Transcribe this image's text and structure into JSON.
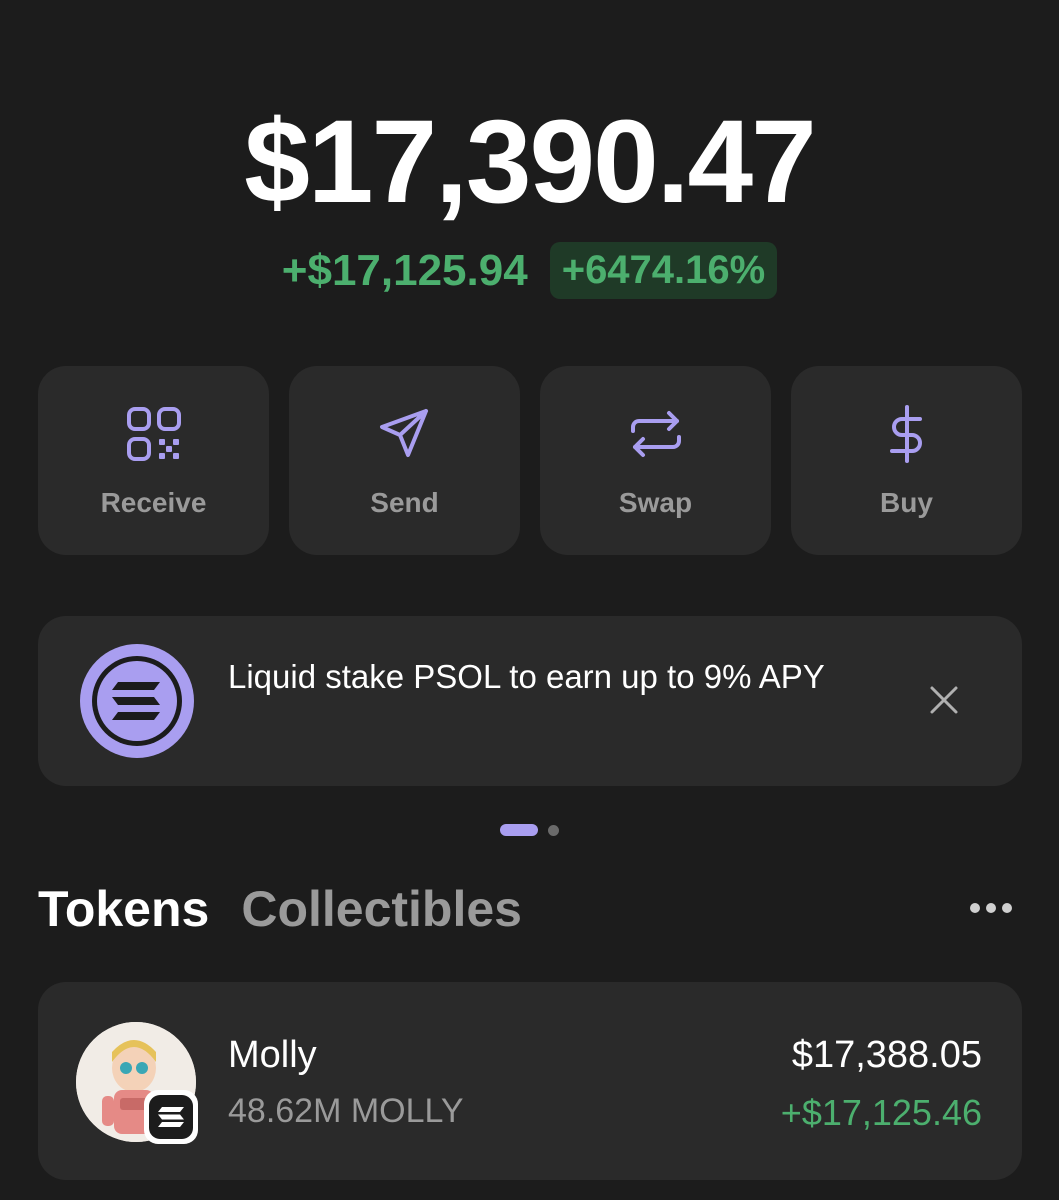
{
  "portfolio": {
    "balance": "$17,390.47",
    "change_abs": "+$17,125.94",
    "change_pct": "+6474.16%"
  },
  "actions": [
    {
      "label": "Receive",
      "icon": "qr-code-icon"
    },
    {
      "label": "Send",
      "icon": "send-arrow-icon"
    },
    {
      "label": "Swap",
      "icon": "swap-arrows-icon"
    },
    {
      "label": "Buy",
      "icon": "dollar-icon"
    }
  ],
  "promo": {
    "text": "Liquid stake PSOL to earn up to 9% APY",
    "icon": "solana-icon"
  },
  "carousel": {
    "pages": 2,
    "active": 0
  },
  "tabs": [
    {
      "label": "Tokens",
      "active": true
    },
    {
      "label": "Collectibles",
      "active": false
    }
  ],
  "tokens": [
    {
      "name": "Molly",
      "amount": "48.62M MOLLY",
      "value": "$17,388.05",
      "change": "+$17,125.46"
    }
  ],
  "colors": {
    "accent": "#a99ef0",
    "positive": "#4caf6e",
    "background": "#1c1c1c",
    "card": "#2a2a2a"
  }
}
